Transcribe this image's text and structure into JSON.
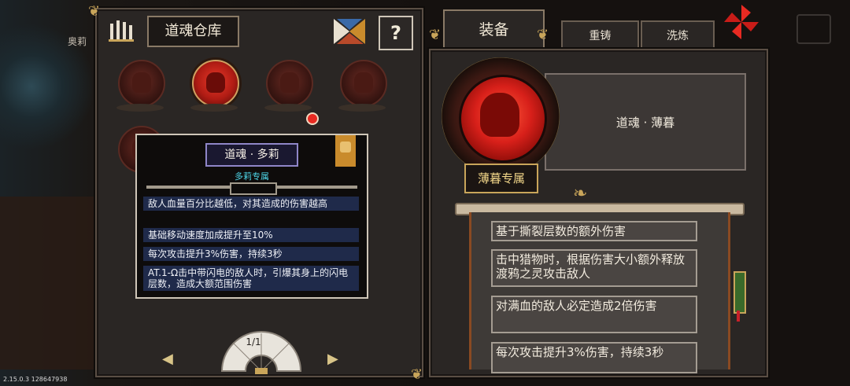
{
  "background": {
    "character_name": "奥莉",
    "version_text": "2.15.0.3 128647938"
  },
  "vault": {
    "title": "道魂仓库",
    "help_label": "?",
    "souls": [
      {
        "name": "soul-1",
        "active": false
      },
      {
        "name": "soul-2",
        "active": true
      },
      {
        "name": "soul-3",
        "active": false
      },
      {
        "name": "soul-4",
        "active": false
      },
      {
        "name": "soul-5",
        "active": false
      }
    ],
    "page_indicator": "1/1"
  },
  "tooltip": {
    "name": "道魂 · 多莉",
    "subtitle": "多莉专属",
    "effects": [
      "敌人血量百分比越低，对其造成的伤害越高",
      "基础移动速度加成提升至10%",
      "每次攻击提升3%伤害，持续3秒",
      "AT.1-Ω击中带闪电的敌人时，引爆其身上的闪电层数，造成大额范围伤害"
    ]
  },
  "equip": {
    "tabs": {
      "equip": "装备",
      "recast": "重铸",
      "refine": "洗炼"
    },
    "soul_name": "道魂 · 薄暮",
    "exclusive_label": "薄暮专属",
    "skills": [
      "基于撕裂层数的额外伤害",
      "击中猎物时，根据伤害大小额外释放渡鸦之灵攻击敌人",
      "对满血的敌人必定造成2倍伤害",
      "每次攻击提升3%伤害，持续3秒"
    ]
  },
  "colors": {
    "accent_gold": "#c9a55a",
    "orb_red": "#d8201a",
    "tooltip_subtitle": "#4ed6e8",
    "tooltip_row_bg": "#1f2a4a"
  }
}
